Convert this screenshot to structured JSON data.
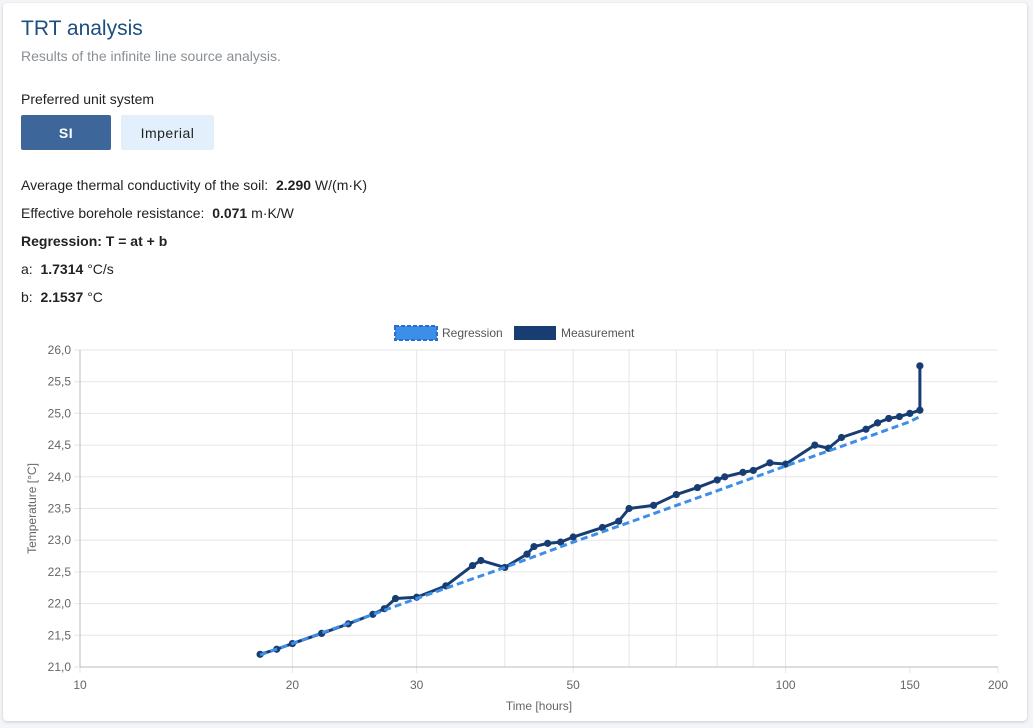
{
  "header": {
    "title": "TRT analysis",
    "subtitle": "Results of the infinite line source analysis."
  },
  "units": {
    "label": "Preferred unit system",
    "options": [
      "SI",
      "Imperial"
    ],
    "selected": "SI"
  },
  "results": {
    "conductivity_label": "Average thermal conductivity of the soil:",
    "conductivity_value": "2.290",
    "conductivity_unit": "W/(m·K)",
    "resistance_label": "Effective borehole resistance:",
    "resistance_value": "0.071",
    "resistance_unit": "m·K/W",
    "regression_title": "Regression: T = at + b",
    "a_label": "a:",
    "a_value": "1.7314",
    "a_unit": "°C/s",
    "b_label": "b:",
    "b_value": "2.1537",
    "b_unit": "°C"
  },
  "colors": {
    "regression": "#3d8ee8",
    "measurement": "#173d72",
    "grid": "#e6e6e6",
    "accent": "#1c4e80"
  },
  "chart_data": {
    "type": "line",
    "xscale": "log",
    "xlabel": "Time [hours]",
    "ylabel": "Temperature [°C]",
    "xlim": [
      10,
      200
    ],
    "ylim": [
      21.0,
      26.0
    ],
    "xticks": [
      10,
      20,
      30,
      50,
      100,
      150,
      200
    ],
    "xtick_labels": [
      "10",
      "20",
      "30",
      "50",
      "100",
      "150",
      "200"
    ],
    "yticks": [
      21.0,
      21.5,
      22.0,
      22.5,
      23.0,
      23.5,
      24.0,
      24.5,
      25.0,
      25.5,
      26.0
    ],
    "ytick_labels": [
      "21,0",
      "21,5",
      "22,0",
      "22,5",
      "23,0",
      "23,5",
      "24,0",
      "24,5",
      "25,0",
      "25,5",
      "26,0"
    ],
    "legend": {
      "position": "top-center",
      "entries": [
        "Regression",
        "Measurement"
      ]
    },
    "grid": true,
    "series": [
      {
        "name": "Regression",
        "style": "dashed",
        "x": [
          18,
          20,
          25,
          30,
          40,
          50,
          60,
          80,
          100,
          120,
          150,
          155
        ],
        "y": [
          21.19,
          21.37,
          21.76,
          22.08,
          22.57,
          22.97,
          23.28,
          23.78,
          24.17,
          24.48,
          24.87,
          24.95
        ]
      },
      {
        "name": "Measurement",
        "style": "solid",
        "x": [
          18,
          19,
          20,
          22,
          24,
          26,
          27,
          28,
          30,
          33,
          36,
          37,
          40,
          43,
          44,
          46,
          48,
          50,
          55,
          58,
          60,
          65,
          70,
          75,
          80,
          82,
          87,
          90,
          95,
          100,
          110,
          115,
          120,
          130,
          135,
          140,
          145,
          150,
          155,
          155
        ],
        "y": [
          21.2,
          21.28,
          21.37,
          21.53,
          21.68,
          21.83,
          21.92,
          22.08,
          22.1,
          22.28,
          22.6,
          22.68,
          22.57,
          22.78,
          22.9,
          22.95,
          22.97,
          23.05,
          23.2,
          23.3,
          23.5,
          23.55,
          23.72,
          23.83,
          23.95,
          24.0,
          24.07,
          24.1,
          24.22,
          24.2,
          24.5,
          24.45,
          24.62,
          24.75,
          24.85,
          24.92,
          24.95,
          25.0,
          25.05,
          25.75
        ]
      }
    ]
  }
}
